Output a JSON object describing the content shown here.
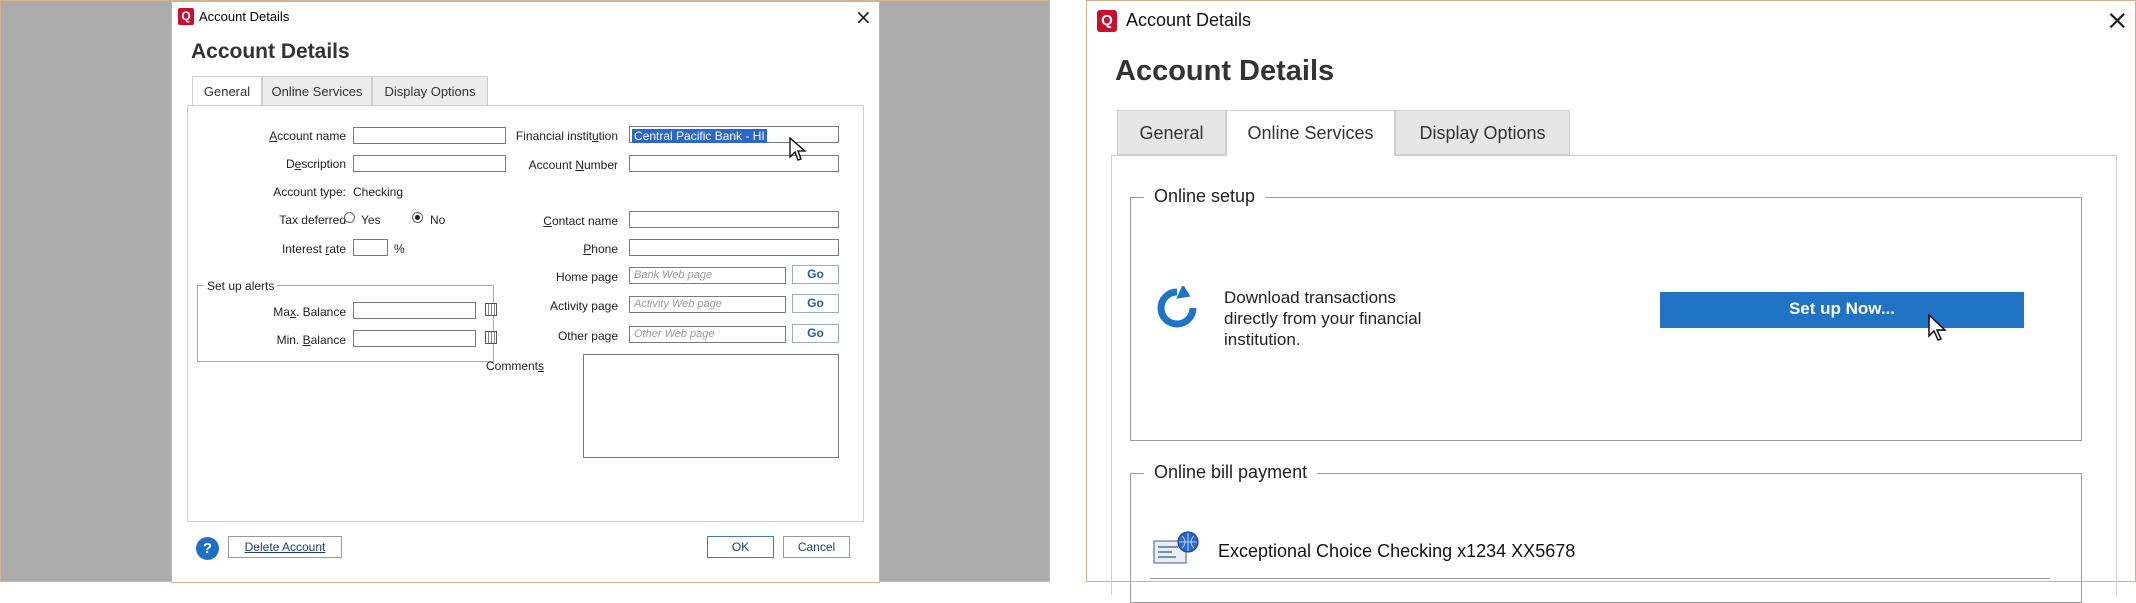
{
  "left": {
    "window_title": "Account Details",
    "heading": "Account Details",
    "tabs": [
      "General",
      "Online Services",
      "Display Options"
    ],
    "form": {
      "account_name_label_pre": "",
      "account_name_label_u": "A",
      "account_name_label_post": "ccount name",
      "description_label_pre": "D",
      "description_label_u": "e",
      "description_label_post": "scription",
      "account_type_label": "Account type:",
      "account_type_value": "Checking",
      "tax_deferred_label": "Tax deferred",
      "yes_label": "Yes",
      "no_label": "No",
      "interest_rate_label_pre": "Interest ",
      "interest_rate_label_u": "r",
      "interest_rate_label_post": "ate",
      "percent": "%",
      "alerts_legend": "Set up alerts",
      "max_balance_label_pre": "Ma",
      "max_balance_label_u": "x",
      "max_balance_label_post": ". Balance",
      "min_balance_label_pre": "Min. ",
      "min_balance_label_u": "B",
      "min_balance_label_post": "alance",
      "financial_institution_label_pre": "Financial instit",
      "financial_institution_label_u": "u",
      "financial_institution_label_post": "tion",
      "financial_institution_value": "Central Pacific Bank - HI",
      "account_number_label_pre": "Account ",
      "account_number_label_u": "N",
      "account_number_label_post": "umber",
      "contact_name_label_pre": "",
      "contact_name_label_u": "C",
      "contact_name_label_post": "ontact name",
      "phone_label_pre": "",
      "phone_label_u": "P",
      "phone_label_post": "hone",
      "home_page_label": "Home page",
      "home_page_placeholder": "Bank Web page",
      "activity_page_label": "Activity page",
      "activity_page_placeholder": "Activity Web page",
      "other_page_label": "Other page",
      "other_page_placeholder": "Other Web page",
      "go_label": "Go",
      "comments_label_pre": "Comment",
      "comments_label_u": "s",
      "comments_label_post": ""
    },
    "footer": {
      "help_icon_glyph": "?",
      "delete_account": "Delete Account",
      "ok": "OK",
      "cancel": "Cancel"
    },
    "colors": {
      "brand": "#c8102e",
      "accent": "#1f6fc6"
    }
  },
  "right": {
    "window_title": "Account Details",
    "heading": "Account Details",
    "tabs": [
      "General",
      "Online Services",
      "Display Options"
    ],
    "online_setup": {
      "legend": "Online setup",
      "description": "Download transactions directly from your financial institution.",
      "desc_line1": "Download transactions",
      "desc_line2": "directly from your financial",
      "desc_line3": "institution.",
      "button": "Set up Now..."
    },
    "online_bill_payment": {
      "legend": "Online bill payment",
      "account": "Exceptional Choice Checking x1234 XX5678"
    },
    "colors": {
      "button": "#1f72c4"
    }
  },
  "icons": {
    "app": "Q",
    "close": "×"
  }
}
